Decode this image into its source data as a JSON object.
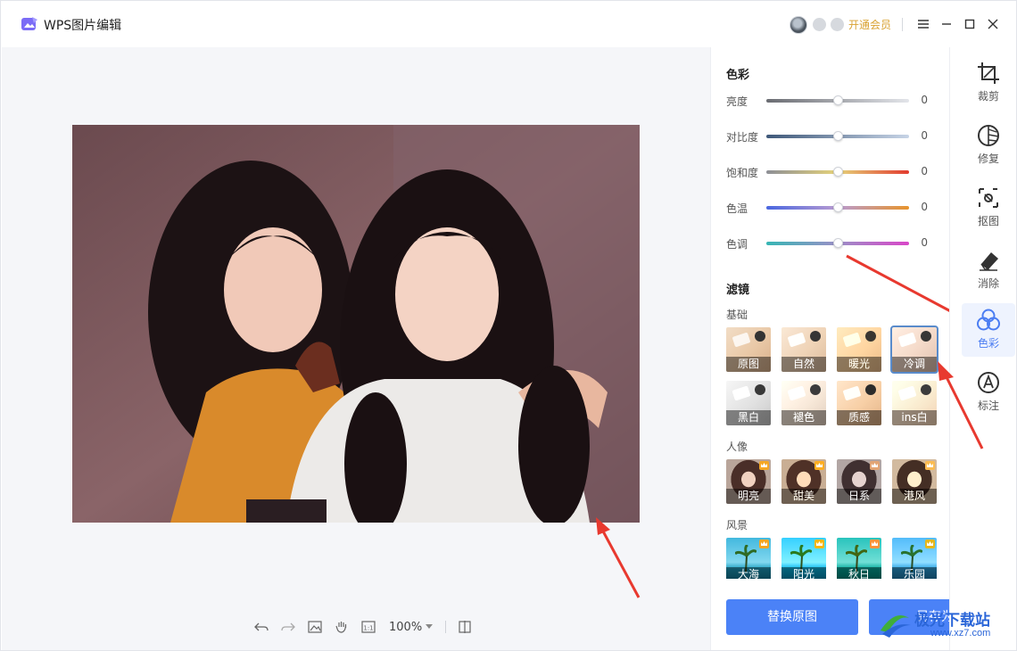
{
  "titlebar": {
    "app_title": "WPS图片编辑",
    "vip_label": "开通会员"
  },
  "canvas": {
    "zoom_label": "100%"
  },
  "color_section": {
    "title": "色彩",
    "sliders": [
      {
        "label": "亮度",
        "value": "0",
        "level": 0.5
      },
      {
        "label": "对比度",
        "value": "0",
        "level": 0.5
      },
      {
        "label": "饱和度",
        "value": "0",
        "level": 0.5
      },
      {
        "label": "色温",
        "value": "0",
        "level": 0.5
      },
      {
        "label": "色调",
        "value": "0",
        "level": 0.5
      }
    ]
  },
  "filter_section": {
    "title": "滤镜",
    "groups": [
      {
        "title": "基础",
        "items": [
          "原图",
          "自然",
          "暖光",
          "冷调",
          "黑白",
          "褪色",
          "质感",
          "ins白"
        ],
        "selected": "冷调"
      },
      {
        "title": "人像",
        "items": [
          "明亮",
          "甜美",
          "日系",
          "港风"
        ]
      },
      {
        "title": "风景",
        "items": [
          "大海",
          "阳光",
          "秋日",
          "乐园"
        ]
      }
    ]
  },
  "actions": {
    "replace_label": "替换原图",
    "save_as_label": "另存为"
  },
  "tools": [
    {
      "label": "裁剪",
      "icon": "crop-icon"
    },
    {
      "label": "修复",
      "icon": "repair-icon"
    },
    {
      "label": "抠图",
      "icon": "cutout-icon"
    },
    {
      "label": "消除",
      "icon": "eraser-icon"
    },
    {
      "label": "色彩",
      "icon": "color-icon",
      "active": true
    },
    {
      "label": "标注",
      "icon": "annotate-icon"
    }
  ],
  "watermark": {
    "text": "极光下载站",
    "url": "www.xz7.com"
  },
  "colors": {
    "accent": "#4b82f7",
    "vip": "#d9a233",
    "arrow": "#e8392f"
  }
}
